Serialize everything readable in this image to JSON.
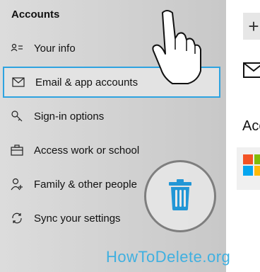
{
  "sidebar": {
    "title": "Accounts",
    "items": [
      {
        "label": "Your info",
        "icon": "contact-card-icon"
      },
      {
        "label": "Email & app accounts",
        "icon": "mail-icon",
        "selected": true
      },
      {
        "label": "Sign-in options",
        "icon": "key-icon"
      },
      {
        "label": "Access work or school",
        "icon": "briefcase-icon"
      },
      {
        "label": "Family & other people",
        "icon": "add-person-icon"
      },
      {
        "label": "Sync your settings",
        "icon": "sync-icon"
      }
    ]
  },
  "main": {
    "add_button_label": "+",
    "section_heading": "Acc"
  },
  "overlay": {
    "watermark": "HowToDelete.org",
    "trash_icon": "trash-icon",
    "pointer_icon": "hand-pointer-icon"
  },
  "colors": {
    "accent": "#2ea3e0",
    "trash": "#2196d6",
    "watermark": "#40b0e0"
  }
}
